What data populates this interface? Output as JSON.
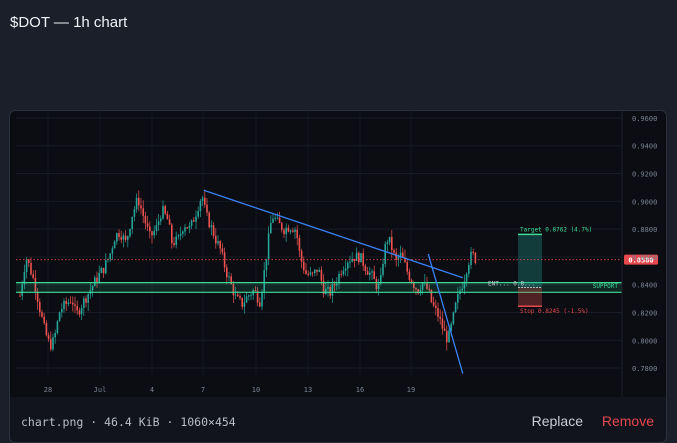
{
  "page": {
    "title": "$DOT — 1h chart"
  },
  "footer": {
    "file_name": "chart.png",
    "file_size": "46.4 KiB",
    "file_dims": "1060×454",
    "separator": "·",
    "replace_label": "Replace",
    "remove_label": "Remove"
  },
  "chart_data": {
    "type": "candlestick",
    "symbol": "$DOT",
    "interval": "1h",
    "y_ticks": [
      "0.9600",
      "0.9400",
      "0.9200",
      "0.9000",
      "0.8800",
      "0.8600",
      "0.8400",
      "0.8200",
      "0.8000",
      "0.7800"
    ],
    "y_range": [
      0.775,
      0.965
    ],
    "x_ticks": [
      "28",
      "Jul",
      "4",
      "7",
      "10",
      "13",
      "16",
      "19"
    ],
    "current_price": "0.8580",
    "current_price_value": 0.858,
    "support": {
      "label": "SUPPORT",
      "low": 0.8345,
      "high": 0.8415
    },
    "trade": {
      "target_label": "Target 0.8762 (4.7%)",
      "target": 0.8762,
      "stop_label": "Stop 0.8245 (-1.5%)",
      "stop": 0.8245,
      "entry_label": "ENT... 0.8...",
      "entry": 0.838
    },
    "trendline": {
      "from": {
        "x": "7",
        "y": 0.908
      },
      "to": {
        "x": "22",
        "y": 0.845
      }
    },
    "projection": {
      "from": {
        "x": "20",
        "y": 0.862
      },
      "to": {
        "x": "22",
        "y": 0.776
      }
    },
    "colors": {
      "up": "#26a69a",
      "down": "#ef5350",
      "trend": "#3b82f6",
      "support": "#3ddc97",
      "price": "#e5484d"
    },
    "path_points": [
      [
        0,
        0.832
      ],
      [
        6,
        0.86
      ],
      [
        10,
        0.852
      ],
      [
        15,
        0.84
      ],
      [
        20,
        0.822
      ],
      [
        25,
        0.806
      ],
      [
        30,
        0.796
      ],
      [
        34,
        0.8
      ],
      [
        40,
        0.822
      ],
      [
        46,
        0.826
      ],
      [
        52,
        0.83
      ],
      [
        56,
        0.818
      ],
      [
        62,
        0.826
      ],
      [
        70,
        0.836
      ],
      [
        78,
        0.846
      ],
      [
        84,
        0.852
      ],
      [
        90,
        0.862
      ],
      [
        95,
        0.875
      ],
      [
        100,
        0.878
      ],
      [
        106,
        0.87
      ],
      [
        112,
        0.89
      ],
      [
        118,
        0.902
      ],
      [
        124,
        0.888
      ],
      [
        130,
        0.874
      ],
      [
        136,
        0.88
      ],
      [
        142,
        0.894
      ],
      [
        148,
        0.886
      ],
      [
        152,
        0.87
      ],
      [
        158,
        0.872
      ],
      [
        164,
        0.884
      ],
      [
        170,
        0.88
      ],
      [
        176,
        0.892
      ],
      [
        182,
        0.905
      ],
      [
        186,
        0.89
      ],
      [
        192,
        0.88
      ],
      [
        196,
        0.872
      ],
      [
        200,
        0.866
      ],
      [
        206,
        0.85
      ],
      [
        212,
        0.838
      ],
      [
        216,
        0.83
      ],
      [
        222,
        0.826
      ],
      [
        228,
        0.832
      ],
      [
        234,
        0.836
      ],
      [
        240,
        0.828
      ],
      [
        244,
        0.848
      ],
      [
        248,
        0.87
      ],
      [
        252,
        0.89
      ],
      [
        258,
        0.884
      ],
      [
        264,
        0.88
      ],
      [
        270,
        0.882
      ],
      [
        276,
        0.88
      ],
      [
        280,
        0.86
      ],
      [
        286,
        0.848
      ],
      [
        292,
        0.846
      ],
      [
        298,
        0.852
      ],
      [
        304,
        0.836
      ],
      [
        310,
        0.834
      ],
      [
        316,
        0.842
      ],
      [
        322,
        0.852
      ],
      [
        328,
        0.858
      ],
      [
        334,
        0.86
      ],
      [
        340,
        0.86
      ],
      [
        346,
        0.852
      ],
      [
        352,
        0.846
      ],
      [
        356,
        0.84
      ],
      [
        360,
        0.838
      ],
      [
        364,
        0.864
      ],
      [
        368,
        0.874
      ],
      [
        372,
        0.866
      ],
      [
        376,
        0.856
      ],
      [
        380,
        0.862
      ],
      [
        384,
        0.856
      ],
      [
        388,
        0.848
      ],
      [
        394,
        0.84
      ],
      [
        398,
        0.836
      ],
      [
        402,
        0.842
      ],
      [
        408,
        0.836
      ],
      [
        412,
        0.826
      ],
      [
        418,
        0.818
      ],
      [
        424,
        0.806
      ],
      [
        428,
        0.8
      ],
      [
        432,
        0.812
      ],
      [
        436,
        0.826
      ],
      [
        440,
        0.836
      ],
      [
        444,
        0.844
      ],
      [
        448,
        0.856
      ],
      [
        452,
        0.862
      ],
      [
        456,
        0.858
      ]
    ]
  }
}
